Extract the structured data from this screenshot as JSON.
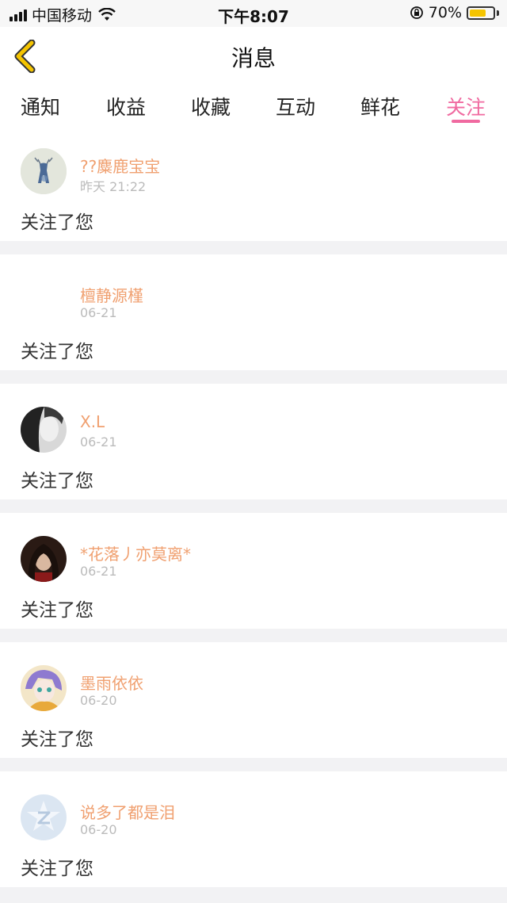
{
  "status_bar": {
    "carrier": "中国移动",
    "time": "下午8:07",
    "battery": "70%",
    "battery_level": 0.7
  },
  "header": {
    "title": "消息",
    "back_icon": "chevron-left-icon"
  },
  "tabs": [
    {
      "label": "通知"
    },
    {
      "label": "收益"
    },
    {
      "label": "收藏"
    },
    {
      "label": "互动"
    },
    {
      "label": "鲜花"
    },
    {
      "label": "关注",
      "active": true
    }
  ],
  "messages": [
    {
      "name": "??麋鹿宝宝",
      "time": "昨天 21:22",
      "text": "关注了您"
    },
    {
      "name": "檀静源槿",
      "time": "06-21",
      "text": "关注了您"
    },
    {
      "name": "X.L",
      "time": "06-21",
      "text": "关注了您"
    },
    {
      "name": "*花落丿亦莫离*",
      "time": "06-21",
      "text": "关注了您"
    },
    {
      "name": "墨雨依依",
      "time": "06-20",
      "text": "关注了您"
    },
    {
      "name": "说多了都是泪",
      "time": "06-20",
      "text": "关注了您"
    }
  ],
  "colors": {
    "accent": "#f06aa0",
    "username": "#f0a070",
    "back_arrow": "#f4c400"
  }
}
